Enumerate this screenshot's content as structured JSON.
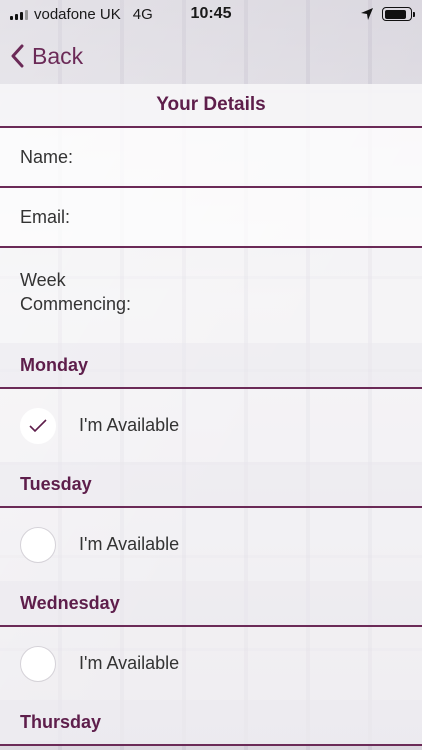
{
  "status_bar": {
    "carrier": "vodafone UK",
    "network": "4G",
    "time": "10:45"
  },
  "nav": {
    "back_label": "Back"
  },
  "title": "Your Details",
  "fields": {
    "name_label": "Name:",
    "email_label": "Email:",
    "week_label_line1": "Week",
    "week_label_line2": "Commencing:"
  },
  "days": [
    {
      "name": "Monday",
      "option_label": "I'm Available",
      "checked": true
    },
    {
      "name": "Tuesday",
      "option_label": "I'm Available",
      "checked": false
    },
    {
      "name": "Wednesday",
      "option_label": "I'm Available",
      "checked": false
    },
    {
      "name": "Thursday"
    }
  ],
  "colors": {
    "accent": "#6b2a57",
    "heading": "#5e1e4b"
  }
}
